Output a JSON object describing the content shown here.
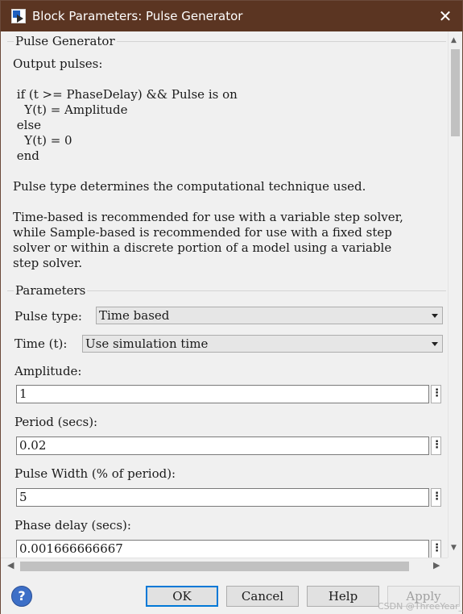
{
  "window": {
    "title": "Block Parameters: Pulse Generator",
    "close_glyph": "✕",
    "icon": "simulink-block-icon"
  },
  "block_group": {
    "label": "Pulse Generator",
    "description_lines": [
      "Output pulses:",
      "",
      " if (t >= PhaseDelay) && Pulse is on",
      "   Y(t) = Amplitude",
      " else",
      "   Y(t) = 0",
      " end",
      "",
      "Pulse type determines the computational technique used.",
      "",
      "Time-based is recommended for use with a variable step solver,",
      "while Sample-based is recommended for use with a fixed step",
      "solver or within a discrete portion of a model using a variable",
      "step solver."
    ]
  },
  "parameters_group": {
    "label": "Parameters",
    "pulse_type": {
      "label": "Pulse type:",
      "value": "Time based"
    },
    "time": {
      "label": "Time (t):",
      "value": "Use simulation time"
    },
    "amplitude": {
      "label": "Amplitude:",
      "value": "1"
    },
    "period": {
      "label": "Period (secs):",
      "value": "0.02"
    },
    "pulse_width": {
      "label": "Pulse Width (% of period):",
      "value": "5"
    },
    "phase_delay": {
      "label": "Phase delay (secs):",
      "value": "0.001666666667"
    },
    "kebab_glyph": "⋮"
  },
  "footer": {
    "help_icon_glyph": "?",
    "ok_label": "OK",
    "cancel_label": "Cancel",
    "help_label": "Help",
    "apply_label": "Apply",
    "watermark": "CSDN @ThreeYear_s"
  },
  "colors": {
    "titlebar": "#5b3522",
    "accent_border": "#0078d7",
    "window_bg": "#f0f0f0"
  }
}
